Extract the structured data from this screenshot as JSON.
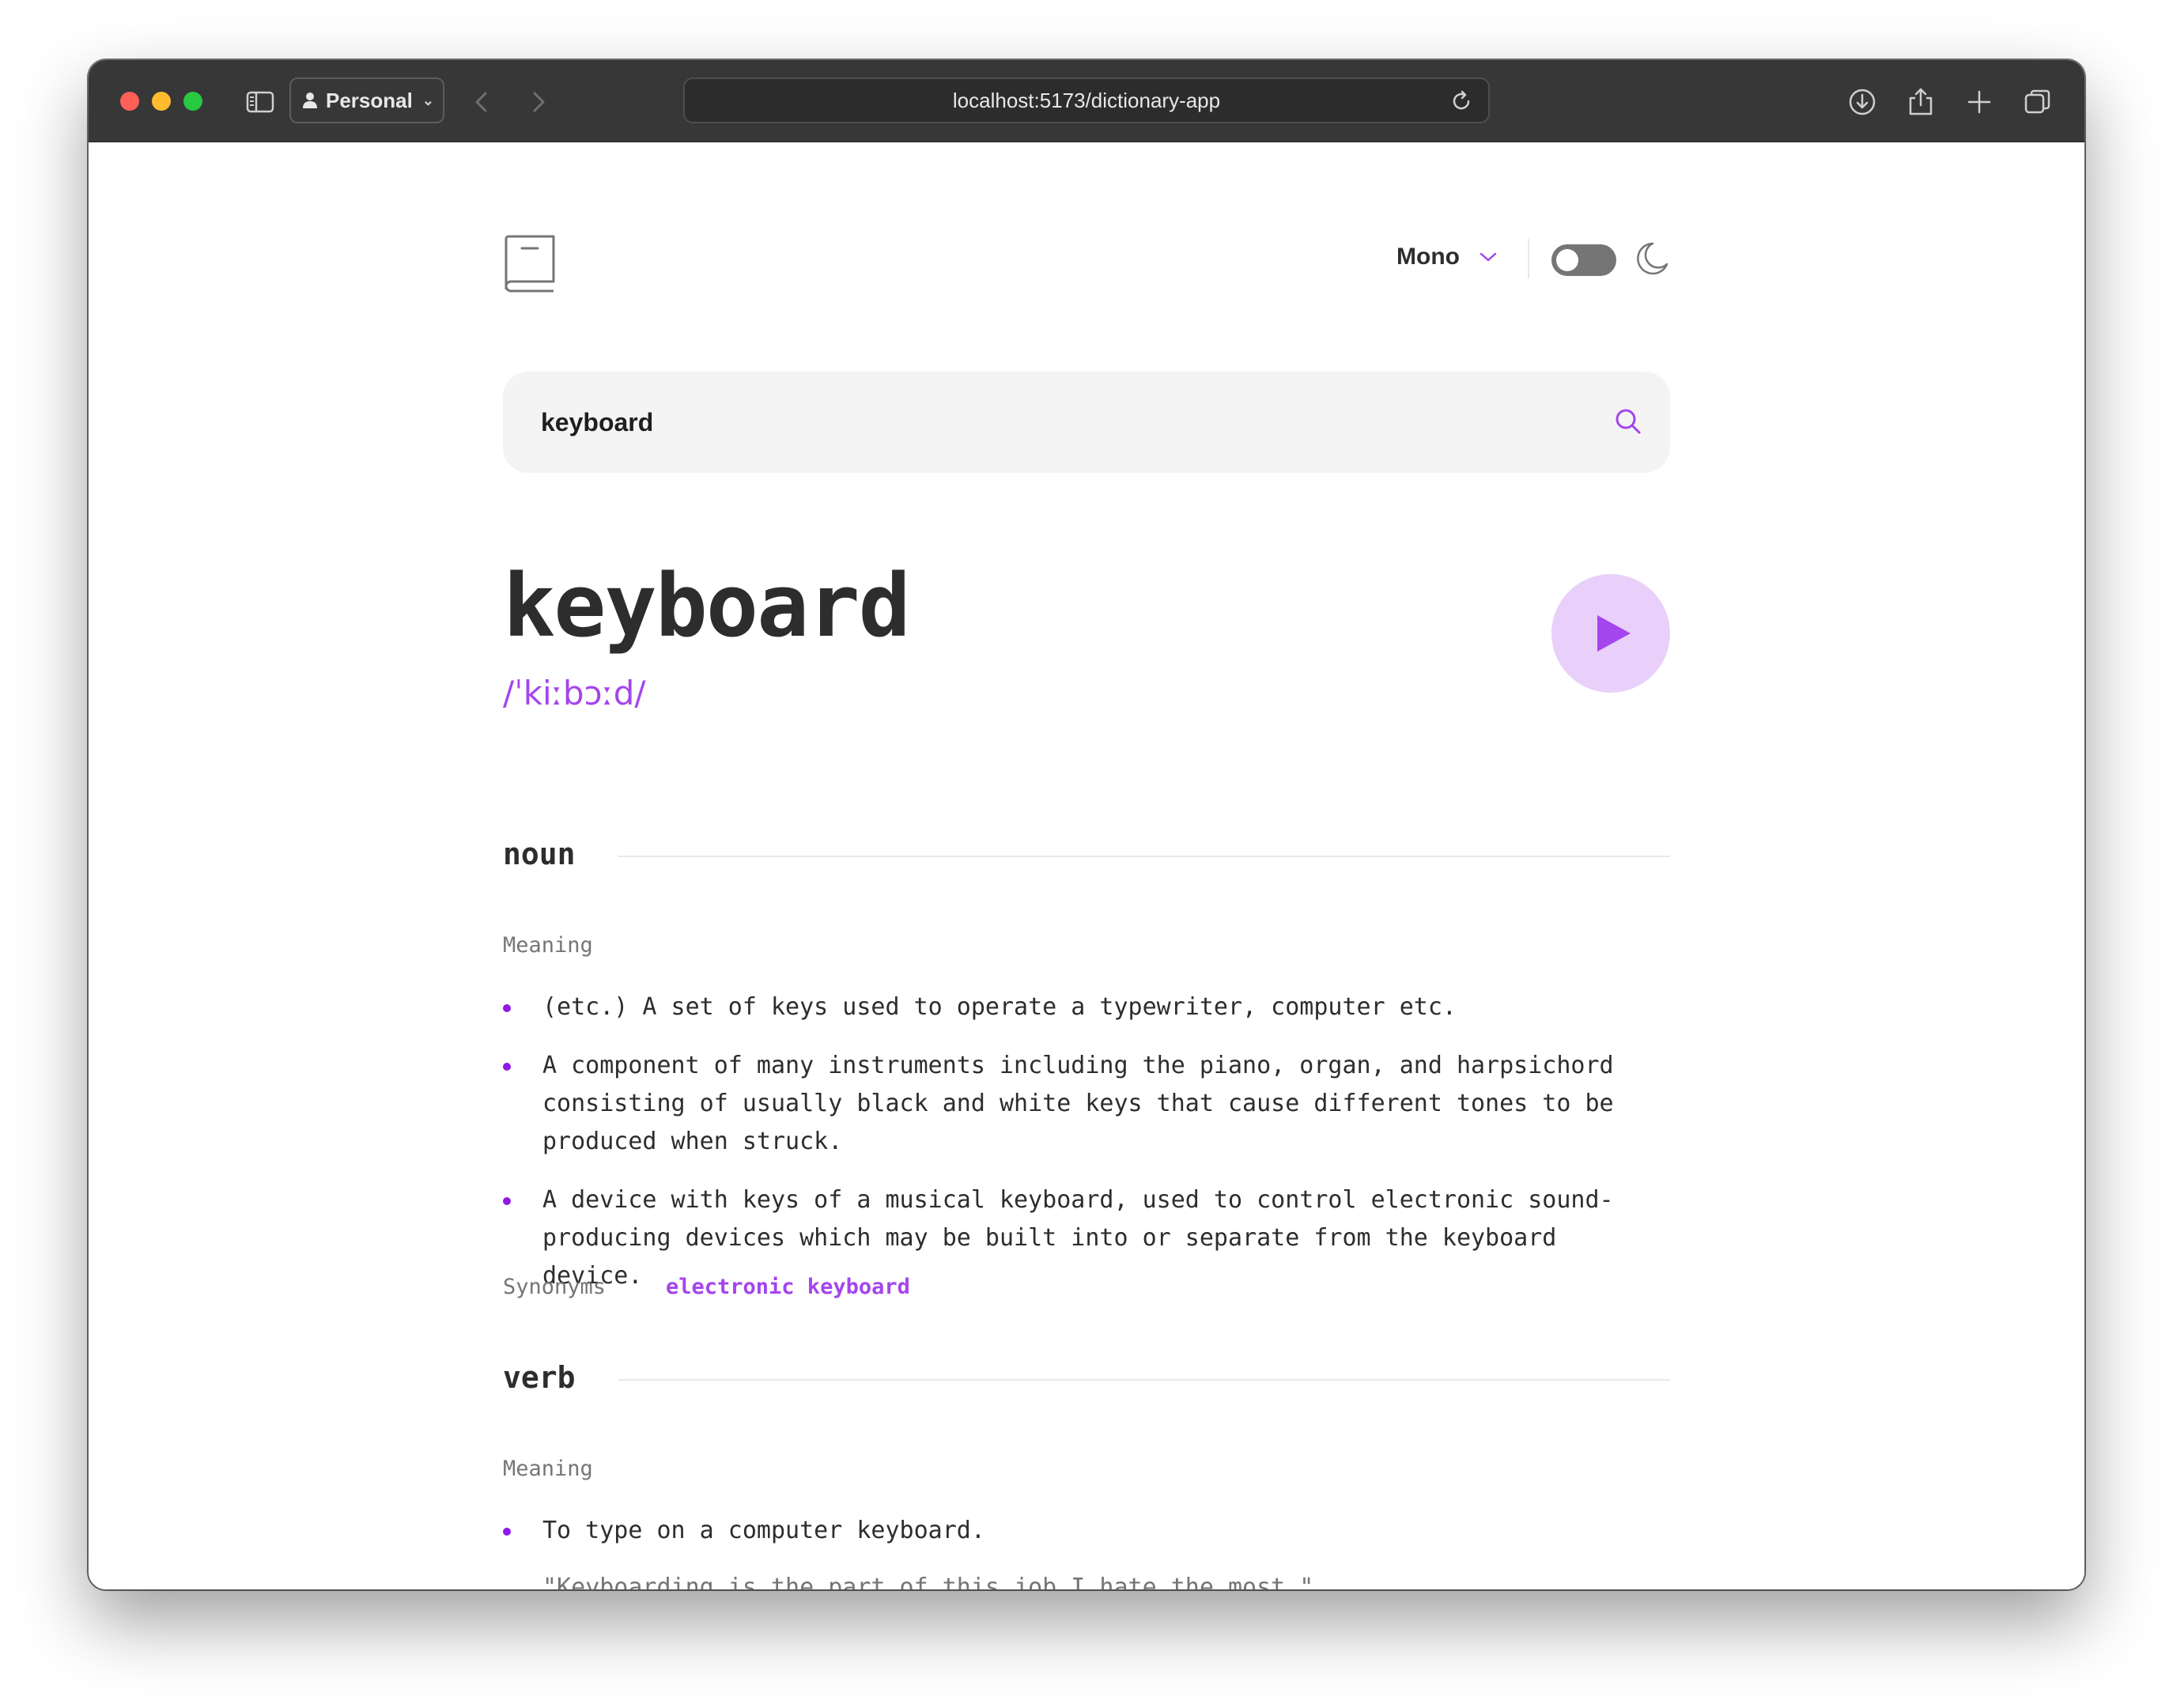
{
  "browser": {
    "profile_label": "Personal",
    "url": "localhost:5173/dictionary-app"
  },
  "header": {
    "font_selector": "Mono",
    "dark_mode_enabled": false
  },
  "search": {
    "value": "keyboard"
  },
  "entry": {
    "word": "keyboard",
    "phonetic": "/ˈkiːbɔːd/",
    "meanings": [
      {
        "part_of_speech": "noun",
        "meaning_label": "Meaning",
        "definitions": [
          {
            "line1": "(etc.) A set of keys used to operate a typewriter, computer etc."
          },
          {
            "line1": "A component of many instruments including the piano, organ, and harpsichord",
            "line2": "consisting of usually black and white keys that cause different tones to be",
            "line3": "produced when struck."
          },
          {
            "line1": "A device with keys of a musical keyboard, used to control electronic sound-",
            "line2": "producing devices which may be built into or separate from the keyboard device."
          }
        ],
        "synonyms_label": "Synonyms",
        "synonyms": [
          "electronic keyboard"
        ]
      },
      {
        "part_of_speech": "verb",
        "meaning_label": "Meaning",
        "definitions": [
          {
            "line1": "To type on a computer keyboard.",
            "example": "\"Keyboarding is the part of this job I hate the most.\""
          }
        ]
      }
    ]
  },
  "colors": {
    "accent": "#a445ed",
    "bullet": "#8f19e8",
    "text": "#2d2d2d",
    "muted": "#757575",
    "titlebar": "#373737"
  },
  "icons": [
    "sidebar-icon",
    "person-icon",
    "back-icon",
    "forward-icon",
    "reload-icon",
    "download-icon",
    "share-icon",
    "plus-icon",
    "tabs-icon",
    "book-icon",
    "chevron-down-icon",
    "moon-icon",
    "search-icon",
    "play-icon"
  ]
}
